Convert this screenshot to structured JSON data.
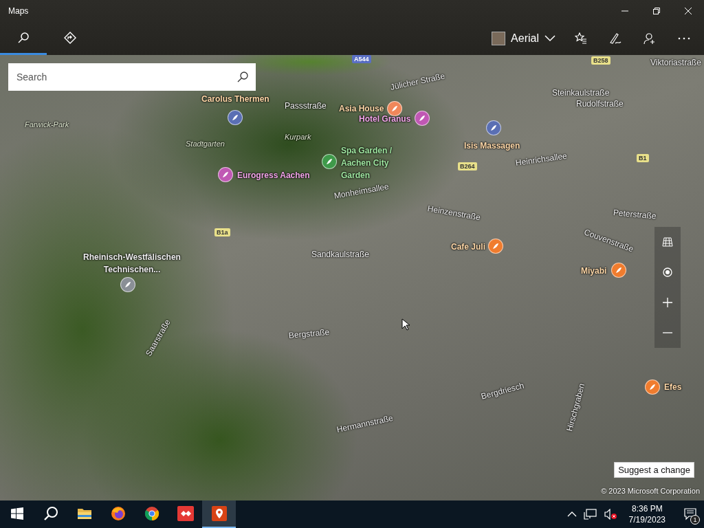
{
  "window": {
    "title": "Maps"
  },
  "nav_tabs": [
    {
      "kind": "search",
      "selected": true
    },
    {
      "kind": "directions",
      "selected": false
    }
  ],
  "map_style": {
    "label": "Aerial"
  },
  "search": {
    "placeholder": "Search"
  },
  "map_labels": [
    {
      "kind": "poi",
      "text": "Carolus Thermen",
      "color": "#5a6fb4"
    },
    {
      "kind": "poi",
      "text": "Asia House",
      "color": "#f0875a"
    },
    {
      "kind": "poi",
      "text": "Hotel Granus",
      "color": "#c058b4"
    },
    {
      "kind": "poi",
      "text": "Eurogress Aachen",
      "color": "#c058b4"
    },
    {
      "kind": "poi",
      "text": "Spa Garden / Aachen City Garden",
      "color": "#3f9a4a"
    },
    {
      "kind": "poi",
      "text": "Isis Massagen",
      "color": "#5a6fb4"
    },
    {
      "kind": "poi",
      "text": "Rheinisch-Westfälischen Technischen...",
      "color": "#8a8f96"
    },
    {
      "kind": "poi",
      "text": "Cafe Juli",
      "color": "#f07c2e"
    },
    {
      "kind": "poi",
      "text": "Miyabi",
      "color": "#f07c2e"
    },
    {
      "kind": "poi",
      "text": "Efes",
      "color": "#f07c2e"
    },
    {
      "kind": "area",
      "text": "Farwick-Park"
    },
    {
      "kind": "area",
      "text": "Stadtgarten"
    },
    {
      "kind": "street",
      "text": "Passstraße"
    },
    {
      "kind": "area",
      "text": "Kurpark"
    },
    {
      "kind": "street",
      "text": "Jülicher Straße"
    },
    {
      "kind": "street",
      "text": "Monheimsallee"
    },
    {
      "kind": "street",
      "text": "Heinrichsallee"
    },
    {
      "kind": "street",
      "text": "Sandkaulstraße"
    },
    {
      "kind": "street",
      "text": "Bergstraße"
    },
    {
      "kind": "street",
      "text": "Hermannstraße"
    },
    {
      "kind": "street",
      "text": "Hirschgraben"
    },
    {
      "kind": "street",
      "text": "Peterstraße"
    },
    {
      "kind": "street",
      "text": "Steinkaulstraße"
    },
    {
      "kind": "street",
      "text": "Rudolfstraße"
    },
    {
      "kind": "street",
      "text": "Viktoriastraße"
    },
    {
      "kind": "street",
      "text": "Heinzenstraße"
    },
    {
      "kind": "street",
      "text": "Couvenstraße"
    },
    {
      "kind": "street",
      "text": "Bergdriesch"
    },
    {
      "kind": "street",
      "text": "Saarstraße"
    },
    {
      "kind": "shield",
      "text": "A544"
    },
    {
      "kind": "shield",
      "text": "B258"
    },
    {
      "kind": "shield",
      "text": "B264"
    },
    {
      "kind": "shield",
      "text": "B1"
    },
    {
      "kind": "shield",
      "text": "B1a"
    }
  ],
  "suggest_button": {
    "label": "Suggest a change"
  },
  "copyright": "© 2023 Microsoft Corporation",
  "taskbar": {
    "apps": [
      {
        "kind": "start",
        "active": false
      },
      {
        "kind": "search",
        "active": false
      },
      {
        "kind": "explorer",
        "active": false
      },
      {
        "kind": "firefox",
        "active": false
      },
      {
        "kind": "chrome",
        "active": false
      },
      {
        "kind": "remote",
        "active": false
      },
      {
        "kind": "maps",
        "active": true
      }
    ],
    "time": "8:36 PM",
    "date": "7/19/2023",
    "notification_count": "1"
  }
}
